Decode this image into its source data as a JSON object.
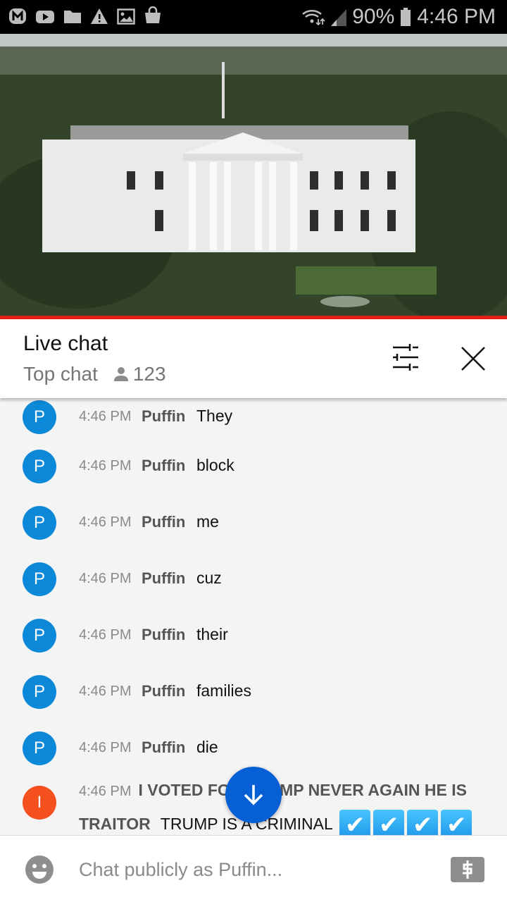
{
  "status_bar": {
    "notification_icons": [
      "m-app-icon",
      "youtube-icon",
      "folder-icon",
      "warning-icon",
      "image-icon",
      "shopping-bag-icon"
    ],
    "battery": "90%",
    "time": "4:46 PM"
  },
  "video": {
    "progress_color": "#e62117"
  },
  "header": {
    "title": "Live chat",
    "subtitle": "Top chat",
    "viewer_count": "123"
  },
  "messages": [
    {
      "avatar_letter": "P",
      "avatar_color": "#0b88d8",
      "time": "4:46 PM",
      "author": "Puffin",
      "text": "They"
    },
    {
      "avatar_letter": "P",
      "avatar_color": "#0b88d8",
      "time": "4:46 PM",
      "author": "Puffin",
      "text": "block"
    },
    {
      "avatar_letter": "P",
      "avatar_color": "#0b88d8",
      "time": "4:46 PM",
      "author": "Puffin",
      "text": "me"
    },
    {
      "avatar_letter": "P",
      "avatar_color": "#0b88d8",
      "time": "4:46 PM",
      "author": "Puffin",
      "text": "cuz"
    },
    {
      "avatar_letter": "P",
      "avatar_color": "#0b88d8",
      "time": "4:46 PM",
      "author": "Puffin",
      "text": "their"
    },
    {
      "avatar_letter": "P",
      "avatar_color": "#0b88d8",
      "time": "4:46 PM",
      "author": "Puffin",
      "text": "families"
    },
    {
      "avatar_letter": "P",
      "avatar_color": "#0b88d8",
      "time": "4:46 PM",
      "author": "Puffin",
      "text": "die"
    }
  ],
  "last_message": {
    "avatar_letter": "I",
    "avatar_color": "#f4511e",
    "time": "4:46 PM",
    "author": "I VOTED FOR TRUMP NEVER AGAIN HE IS TRAITOR",
    "text": "TRUMP IS A CRIMINAL",
    "checkmarks": [
      "✔",
      "✔",
      "✔",
      "✔"
    ]
  },
  "footer": {
    "placeholder": "Chat publicly as Puffin..."
  }
}
